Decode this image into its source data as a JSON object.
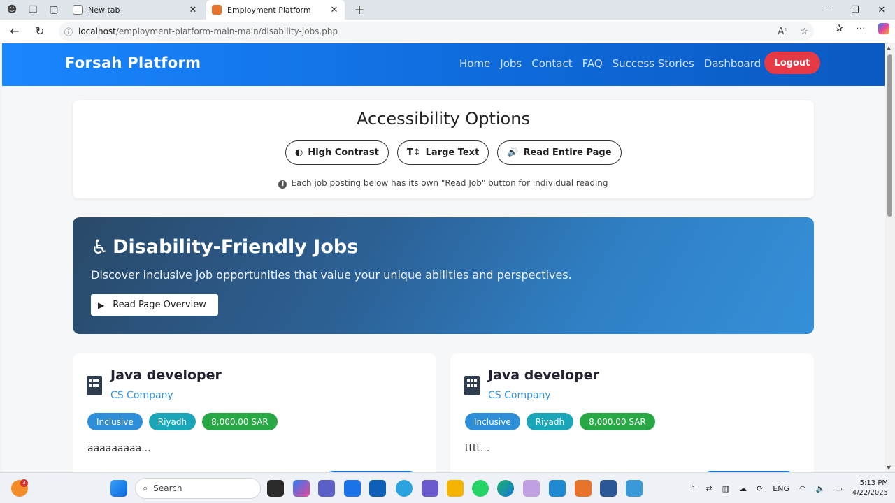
{
  "browser": {
    "tabs": [
      {
        "title": "New tab"
      },
      {
        "title": "Employment Platform"
      }
    ],
    "address": {
      "host": "localhost",
      "path": "/employment-platform-main-main/disability-jobs.php"
    }
  },
  "site": {
    "brand": "Forsah Platform",
    "nav": [
      "Home",
      "Jobs",
      "Contact",
      "FAQ",
      "Success Stories",
      "Dashboard"
    ],
    "logout_label": "Logout"
  },
  "accessibility": {
    "title": "Accessibility Options",
    "buttons": [
      {
        "label": "High Contrast",
        "icon": "contrast-icon"
      },
      {
        "label": "Large Text",
        "icon": "text-size-icon"
      },
      {
        "label": "Read Entire Page",
        "icon": "speaker-icon"
      }
    ],
    "note": "Each job posting below has its own \"Read Job\" button for individual reading"
  },
  "hero": {
    "title": "Disability-Friendly Jobs",
    "subtitle": "Discover inclusive job opportunities that value your unique abilities and perspectives.",
    "overview_label": "Read Page Overview"
  },
  "jobs": [
    {
      "title": "Java developer",
      "company": "CS Company",
      "tags": [
        "Inclusive",
        "Riyadh",
        "8,000.00 SAR"
      ],
      "description": "aaaaaaaaa..."
    },
    {
      "title": "Java developer",
      "company": "CS Company",
      "tags": [
        "Inclusive",
        "Riyadh",
        "8,000.00 SAR"
      ],
      "description": "tttt..."
    }
  ],
  "taskbar": {
    "search_placeholder": "Search",
    "notification_count": "3",
    "language": "ENG",
    "time": "5:13 PM",
    "date": "4/22/2025"
  },
  "colors": {
    "header": "#1a86ff",
    "logout": "#e63946",
    "inclusive_tag": "#2e8ed8",
    "location_tag": "#1aa5b8",
    "salary_tag": "#28a745"
  }
}
